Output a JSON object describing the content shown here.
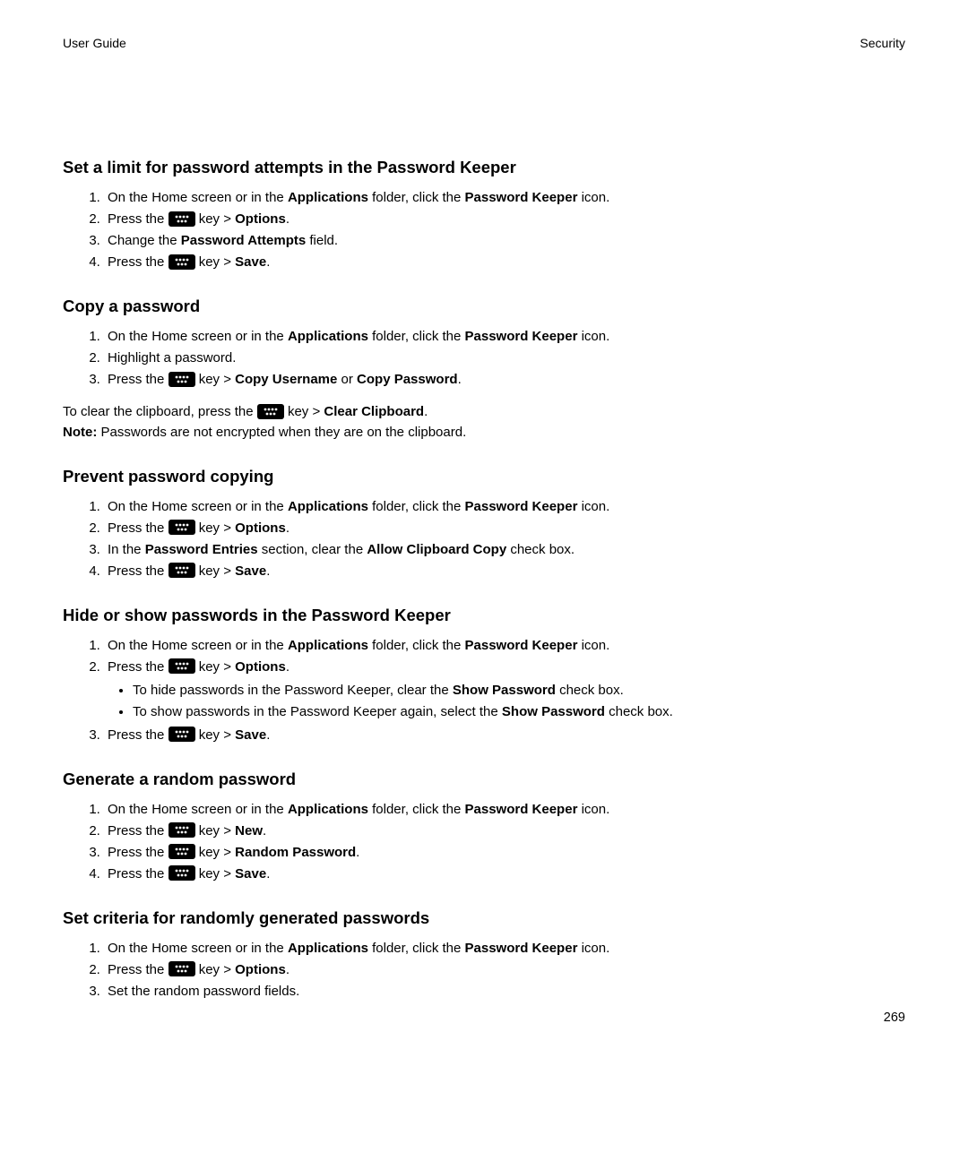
{
  "header": {
    "left": "User Guide",
    "right": "Security"
  },
  "sections": {
    "s1": {
      "heading": "Set a limit for password attempts in the Password Keeper",
      "li1a": "On the Home screen or in the ",
      "li1b": "Applications",
      "li1c": " folder, click the ",
      "li1d": "Password Keeper",
      "li1e": " icon.",
      "li2a": "Press the ",
      "li2b": " key > ",
      "li2c": "Options",
      "li3a": "Change the ",
      "li3b": "Password Attempts",
      "li3c": " field.",
      "li4a": "Press the ",
      "li4b": " key > ",
      "li4c": "Save"
    },
    "s2": {
      "heading": "Copy a password",
      "li1a": "On the Home screen or in the ",
      "li1b": "Applications",
      "li1c": " folder, click the ",
      "li1d": "Password Keeper",
      "li1e": " icon.",
      "li2": "Highlight a password.",
      "li3a": "Press the ",
      "li3b": " key > ",
      "li3c": "Copy Username",
      "li3d": " or ",
      "li3e": "Copy Password",
      "p1a": "To clear the clipboard, press the ",
      "p1b": " key > ",
      "p1c": "Clear Clipboard",
      "p2a": "Note:",
      "p2b": " Passwords are not encrypted when they are on the clipboard."
    },
    "s3": {
      "heading": "Prevent password copying",
      "li1a": "On the Home screen or in the ",
      "li1b": "Applications",
      "li1c": " folder, click the ",
      "li1d": "Password Keeper",
      "li1e": " icon.",
      "li2a": "Press the ",
      "li2b": " key > ",
      "li2c": "Options",
      "li3a": "In the ",
      "li3b": "Password Entries",
      "li3c": " section, clear the ",
      "li3d": "Allow Clipboard Copy",
      "li3e": " check box.",
      "li4a": "Press the ",
      "li4b": " key > ",
      "li4c": "Save"
    },
    "s4": {
      "heading": "Hide or show passwords in the Password Keeper",
      "li1a": "On the Home screen or in the ",
      "li1b": "Applications",
      "li1c": " folder, click the ",
      "li1d": "Password Keeper",
      "li1e": " icon.",
      "li2a": "Press the ",
      "li2b": " key > ",
      "li2c": "Options",
      "b1a": "To hide passwords in the Password Keeper, clear the ",
      "b1b": "Show Password",
      "b1c": " check box.",
      "b2a": "To show passwords in the Password Keeper again, select the ",
      "b2b": "Show Password",
      "b2c": " check box.",
      "li3a": "Press the ",
      "li3b": " key > ",
      "li3c": "Save"
    },
    "s5": {
      "heading": "Generate a random password",
      "li1a": "On the Home screen or in the ",
      "li1b": "Applications",
      "li1c": " folder, click the ",
      "li1d": "Password Keeper",
      "li1e": " icon.",
      "li2a": "Press the ",
      "li2b": " key > ",
      "li2c": "New",
      "li3a": "Press the ",
      "li3b": " key > ",
      "li3c": "Random Password",
      "li4a": "Press the ",
      "li4b": " key > ",
      "li4c": "Save"
    },
    "s6": {
      "heading": "Set criteria for randomly generated passwords",
      "li1a": "On the Home screen or in the ",
      "li1b": "Applications",
      "li1c": " folder, click the ",
      "li1d": "Password Keeper",
      "li1e": " icon.",
      "li2a": "Press the ",
      "li2b": " key > ",
      "li2c": "Options",
      "li3": "Set the random password fields."
    }
  },
  "pageNumber": "269",
  "punct": {
    "period": "."
  }
}
